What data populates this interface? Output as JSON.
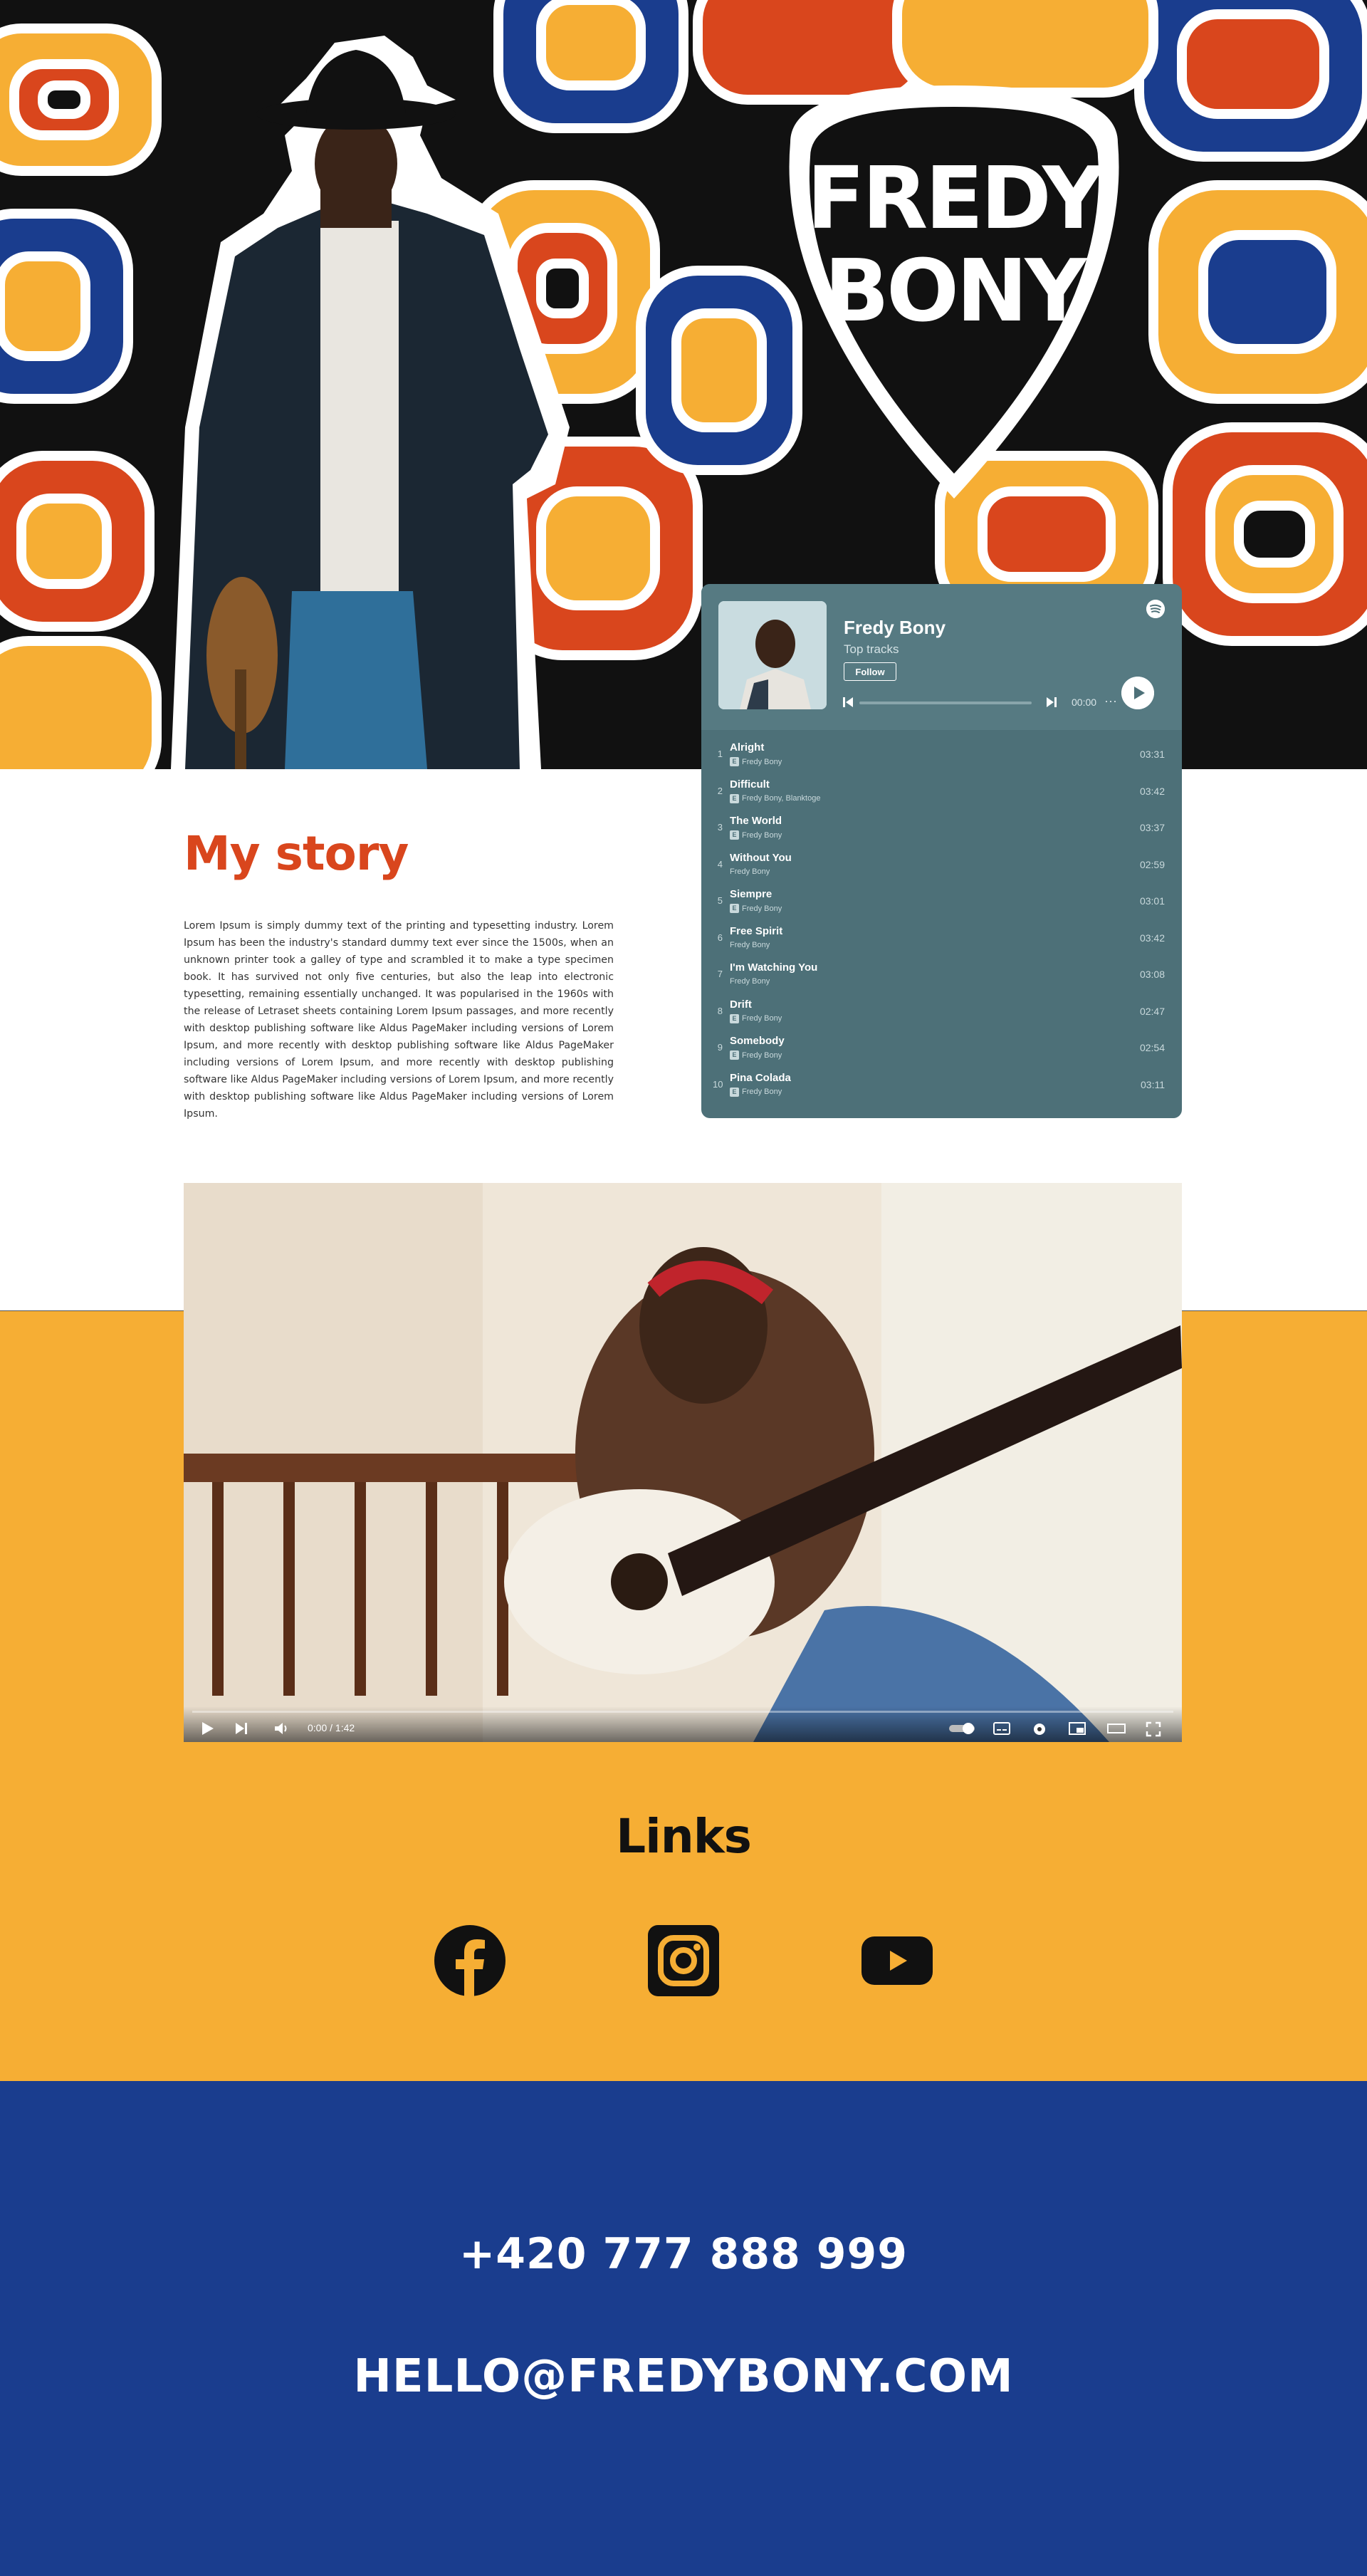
{
  "brand": {
    "logo_text": "FREDY BONY"
  },
  "colors": {
    "accent_red": "#d9461d",
    "yellow": "#f6ae34",
    "blue": "#1a3d8e",
    "widget_bg": "#4d7078"
  },
  "spotify": {
    "artist": "Fredy Bony",
    "subtitle": "Top tracks",
    "follow_label": "Follow",
    "time": "00:00",
    "more": "···",
    "tracks": [
      {
        "num": "1",
        "title": "Alright",
        "artist": "Fredy Bony",
        "explicit": true,
        "duration": "03:31"
      },
      {
        "num": "2",
        "title": "Difficult",
        "artist": "Fredy Bony, Blanktoge",
        "explicit": true,
        "duration": "03:42"
      },
      {
        "num": "3",
        "title": "The World",
        "artist": "Fredy Bony",
        "explicit": true,
        "duration": "03:37"
      },
      {
        "num": "4",
        "title": "Without You",
        "artist": "Fredy Bony",
        "explicit": false,
        "duration": "02:59"
      },
      {
        "num": "5",
        "title": "Siempre",
        "artist": "Fredy Bony",
        "explicit": true,
        "duration": "03:01"
      },
      {
        "num": "6",
        "title": "Free Spirit",
        "artist": "Fredy Bony",
        "explicit": false,
        "duration": "03:42"
      },
      {
        "num": "7",
        "title": "I'm Watching You",
        "artist": "Fredy Bony",
        "explicit": false,
        "duration": "03:08"
      },
      {
        "num": "8",
        "title": "Drift",
        "artist": "Fredy Bony",
        "explicit": true,
        "duration": "02:47"
      },
      {
        "num": "9",
        "title": "Somebody",
        "artist": "Fredy Bony",
        "explicit": true,
        "duration": "02:54"
      },
      {
        "num": "10",
        "title": "Pina Colada",
        "artist": "Fredy Bony",
        "explicit": true,
        "duration": "03:11"
      }
    ]
  },
  "story": {
    "title": "My story",
    "body": "Lorem Ipsum is simply dummy text of the printing and typesetting industry. Lorem Ipsum has been the industry's standard dummy text ever since the 1500s, when an unknown printer took a galley of type and scrambled it to make a type specimen book. It has survived not only five centuries, but also the leap into electronic typesetting, remaining essentially unchanged. It was popularised in the 1960s with the release of Letraset sheets containing Lorem Ipsum passages, and more recently with desktop publishing software like Aldus PageMaker including versions of Lorem Ipsum, and more recently with desktop publishing software like Aldus PageMaker including versions of Lorem Ipsum, and more recently with desktop publishing software like Aldus PageMaker including versions of Lorem Ipsum, and more recently with desktop publishing software like Aldus PageMaker including versions of Lorem Ipsum."
  },
  "video": {
    "time": "0:00 / 1:42"
  },
  "links": {
    "title": "Links",
    "items": [
      {
        "icon": "facebook-icon"
      },
      {
        "icon": "instagram-icon"
      },
      {
        "icon": "youtube-icon"
      }
    ]
  },
  "contact": {
    "phone": "+420 777 888 999",
    "email": "HELLO@FREDYBONY.COM"
  }
}
